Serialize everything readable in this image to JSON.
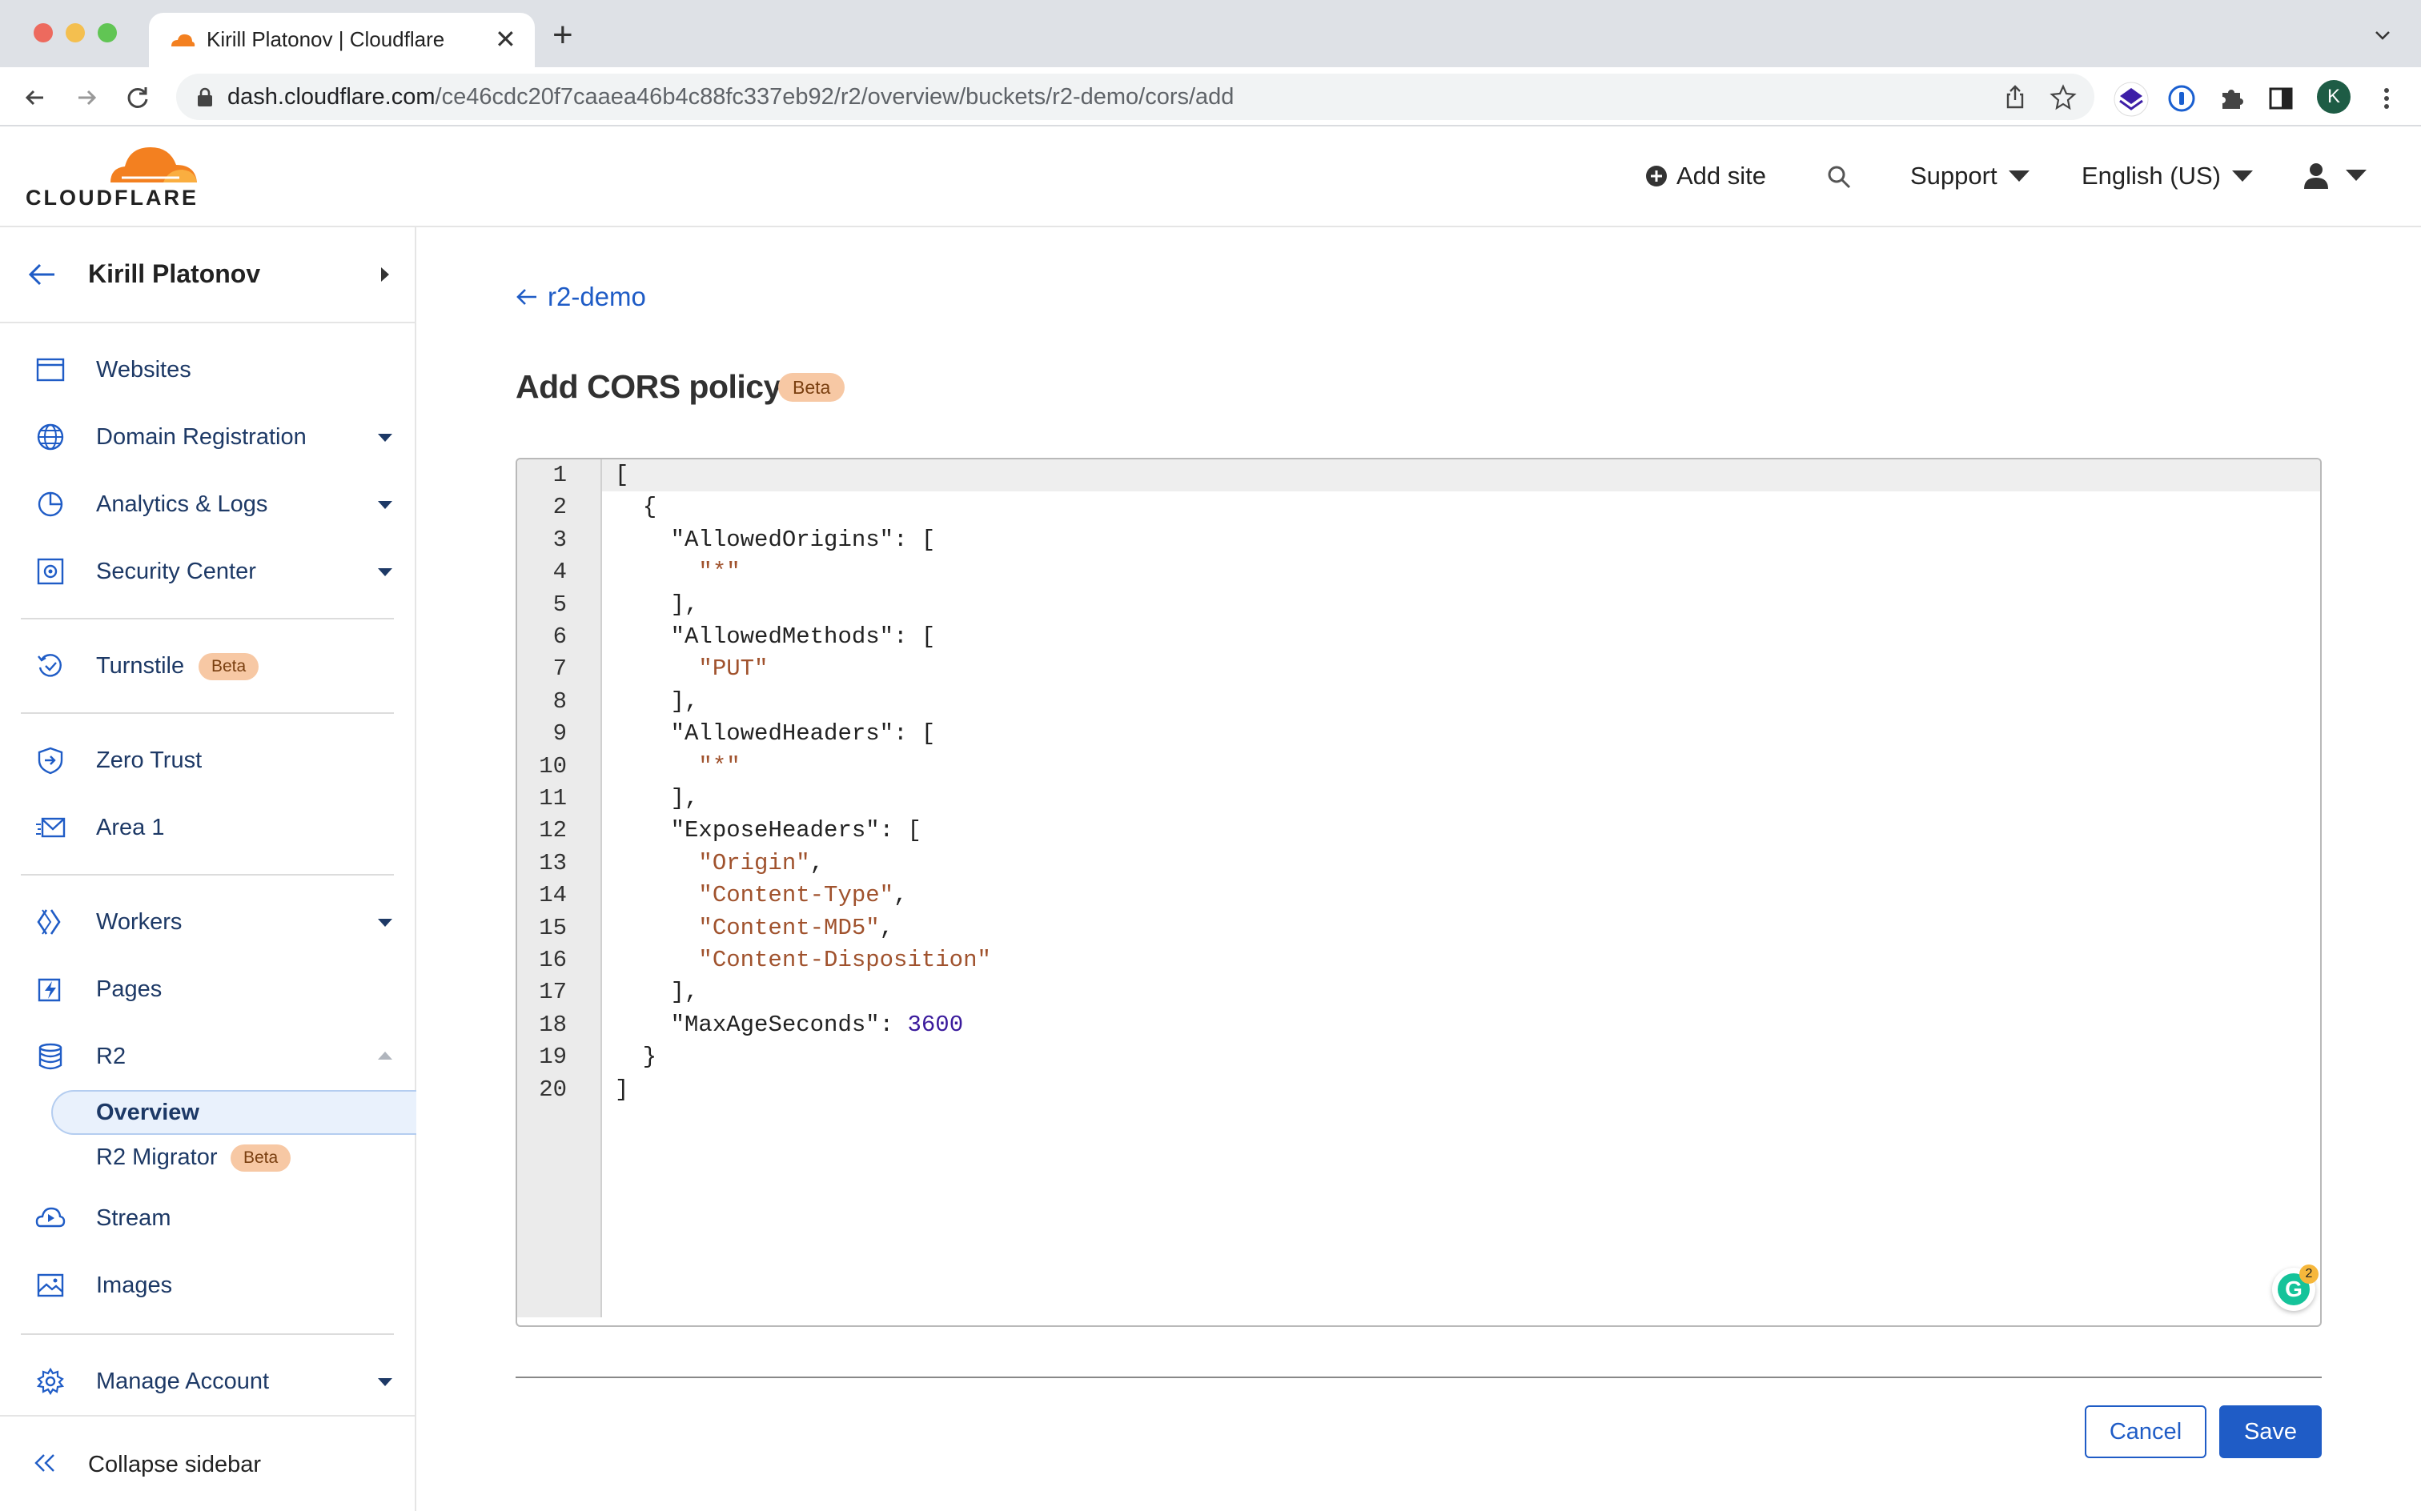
{
  "browser": {
    "tab_title": "Kirill Platonov | Cloudflare",
    "url_host": "dash.cloudflare.com",
    "url_path": "/ce46cdc20f7caaea46b4c88fc337eb92/r2/overview/buckets/r2-demo/cors/add",
    "profile_initial": "K"
  },
  "header": {
    "logo_text": "CLOUDFLARE",
    "add_site": "Add site",
    "support": "Support",
    "language": "English (US)"
  },
  "sidebar": {
    "account_name": "Kirill Platonov",
    "items": {
      "websites": "Websites",
      "domain_registration": "Domain Registration",
      "analytics_logs": "Analytics & Logs",
      "security_center": "Security Center",
      "turnstile": "Turnstile",
      "zero_trust": "Zero Trust",
      "area1": "Area 1",
      "workers": "Workers",
      "pages": "Pages",
      "r2": "R2",
      "overview": "Overview",
      "r2_migrator": "R2 Migrator",
      "stream": "Stream",
      "images": "Images",
      "manage_account": "Manage Account"
    },
    "beta_label": "Beta",
    "collapse": "Collapse sidebar"
  },
  "main": {
    "back_link": "r2-demo",
    "title": "Add CORS policy",
    "title_badge": "Beta",
    "cancel": "Cancel",
    "save": "Save"
  },
  "editor": {
    "lines": [
      "[",
      "  {",
      "    \"AllowedOrigins\": [",
      "      \"*\"",
      "    ],",
      "    \"AllowedMethods\": [",
      "      \"PUT\"",
      "    ],",
      "    \"AllowedHeaders\": [",
      "      \"*\"",
      "    ],",
      "    \"ExposeHeaders\": [",
      "      \"Origin\",",
      "      \"Content-Type\",",
      "      \"Content-MD5\",",
      "      \"Content-Disposition\"",
      "    ],",
      "    \"MaxAgeSeconds\": 3600",
      "  }",
      "]"
    ],
    "grammarly_count": "2"
  },
  "colors": {
    "link_blue": "#1f5cc6",
    "nav_text": "#1d3966",
    "beta_bg": "#f7c8a4",
    "cf_orange": "#f38020"
  }
}
